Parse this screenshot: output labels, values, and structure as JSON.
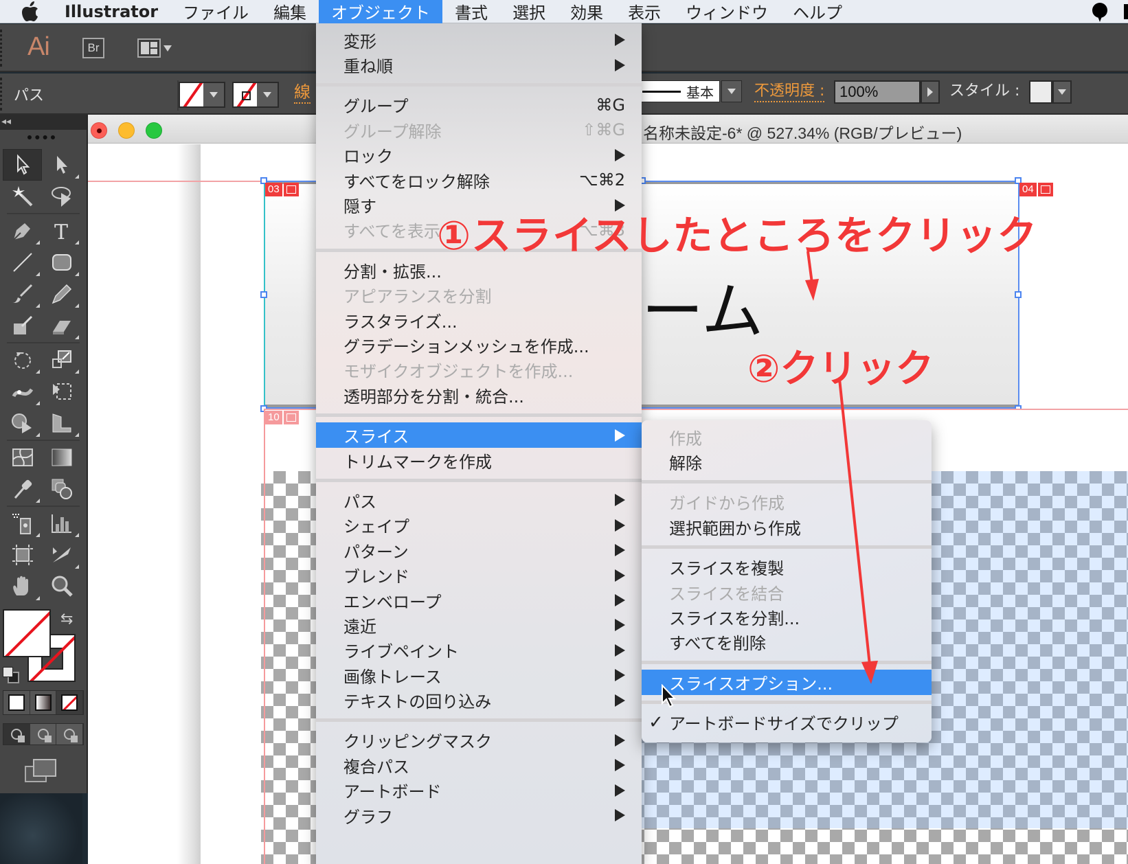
{
  "menubar": {
    "app_name": "Illustrator",
    "items": [
      "ファイル",
      "編集",
      "オブジェクト",
      "書式",
      "選択",
      "効果",
      "表示",
      "ウィンドウ",
      "ヘルプ"
    ],
    "active_item": "オブジェクト"
  },
  "appbar": {
    "logo": "Ai",
    "bridge_label": "Br"
  },
  "controlbar": {
    "selection_type": "パス",
    "stroke_label": "線",
    "profile_value": "基本",
    "opacity_label": "不透明度 :",
    "opacity_value": "100%",
    "style_label": "スタイル :"
  },
  "document": {
    "title": "名称未設定-6* @ 527.34% (RGB/プレビュー)",
    "slice_tags": [
      "03",
      "04",
      "10"
    ],
    "artwork_text": "ーム"
  },
  "annotations": {
    "step1": "①スライスしたところをクリック",
    "step2": "②クリック"
  },
  "object_menu": {
    "groups": [
      [
        {
          "label": "変形",
          "submenu": true
        },
        {
          "label": "重ね順",
          "submenu": true
        }
      ],
      [
        {
          "label": "グループ",
          "shortcut": "⌘G"
        },
        {
          "label": "グループ解除",
          "shortcut": "⇧⌘G",
          "disabled": true
        },
        {
          "label": "ロック",
          "submenu": true
        },
        {
          "label": "すべてをロック解除",
          "shortcut": "⌥⌘2"
        },
        {
          "label": "隠す",
          "submenu": true
        },
        {
          "label": "すべてを表示",
          "shortcut": "⌥⌘3",
          "disabled": true
        }
      ],
      [
        {
          "label": "分割・拡張..."
        },
        {
          "label": "アピアランスを分割",
          "disabled": true
        },
        {
          "label": "ラスタライズ..."
        },
        {
          "label": "グラデーションメッシュを作成..."
        },
        {
          "label": "モザイクオブジェクトを作成...",
          "disabled": true
        },
        {
          "label": "透明部分を分割・統合..."
        }
      ],
      [
        {
          "label": "スライス",
          "submenu": true,
          "highlighted": true
        },
        {
          "label": "トリムマークを作成"
        }
      ],
      [
        {
          "label": "パス",
          "submenu": true
        },
        {
          "label": "シェイプ",
          "submenu": true
        },
        {
          "label": "パターン",
          "submenu": true
        },
        {
          "label": "ブレンド",
          "submenu": true
        },
        {
          "label": "エンベロープ",
          "submenu": true
        },
        {
          "label": "遠近",
          "submenu": true
        },
        {
          "label": "ライブペイント",
          "submenu": true
        },
        {
          "label": "画像トレース",
          "submenu": true
        },
        {
          "label": "テキストの回り込み",
          "submenu": true
        }
      ],
      [
        {
          "label": "クリッピングマスク",
          "submenu": true
        },
        {
          "label": "複合パス",
          "submenu": true
        },
        {
          "label": "アートボード",
          "submenu": true
        },
        {
          "label": "グラフ",
          "submenu": true
        }
      ]
    ]
  },
  "slice_submenu": {
    "groups": [
      [
        {
          "label": "作成",
          "disabled": true
        },
        {
          "label": "解除"
        }
      ],
      [
        {
          "label": "ガイドから作成",
          "disabled": true
        },
        {
          "label": "選択範囲から作成"
        }
      ],
      [
        {
          "label": "スライスを複製"
        },
        {
          "label": "スライスを結合",
          "disabled": true
        },
        {
          "label": "スライスを分割..."
        },
        {
          "label": "すべてを削除"
        }
      ],
      [
        {
          "label": "スライスオプション...",
          "highlighted": true
        }
      ],
      [
        {
          "label": "アートボードサイズでクリップ",
          "checked": true
        }
      ]
    ]
  },
  "colors": {
    "menu_highlight": "#3b8ff2",
    "annotation_red": "#f23838",
    "control_label_orange": "#ef9a3c",
    "slice_tag_red": "#f03c3c",
    "none_swatch_red": "#e8141e"
  }
}
